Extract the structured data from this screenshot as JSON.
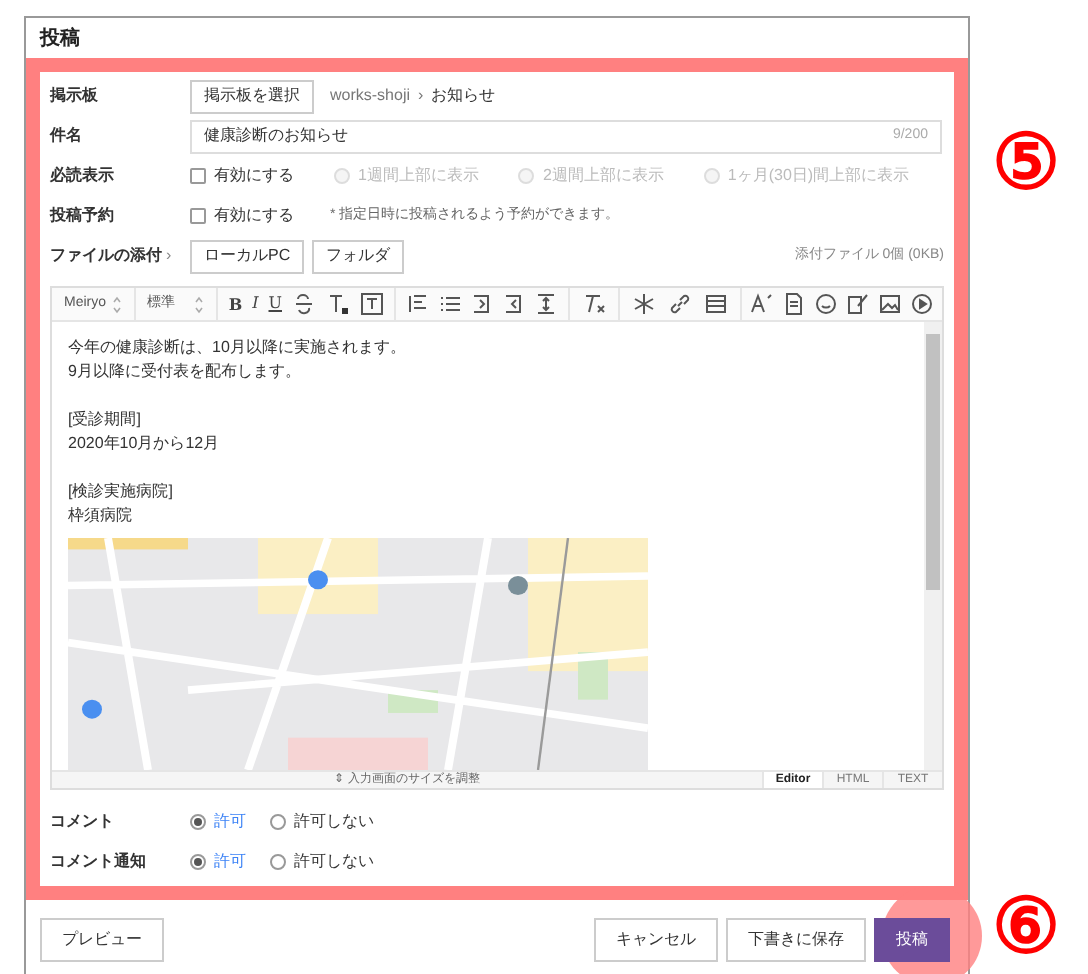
{
  "window": {
    "title": "投稿"
  },
  "form": {
    "board": {
      "label": "掲示板",
      "button": "掲示板を選択",
      "path": "works-shoji",
      "separator": "›",
      "board_name": "お知らせ"
    },
    "subject": {
      "label": "件名",
      "value": "健康診断のお知らせ",
      "counter": "9/200"
    },
    "pinned": {
      "label": "必読表示",
      "enable": {
        "label": "有効にする",
        "checked": false
      },
      "options": [
        {
          "label": "1週間上部に表示",
          "selected": false,
          "disabled": true
        },
        {
          "label": "2週間上部に表示",
          "selected": false,
          "disabled": true
        },
        {
          "label": "1ヶ月(30日)間上部に表示",
          "selected": false,
          "disabled": true
        }
      ]
    },
    "schedule": {
      "label": "投稿予約",
      "enable": {
        "label": "有効にする",
        "checked": false
      },
      "note": "* 指定日時に投稿されるよう予約ができます。"
    },
    "attachment": {
      "label": "ファイルの添付",
      "arrow": "›",
      "buttons": [
        "ローカルPC",
        "フォルダ"
      ],
      "summary": "添付ファイル 0個 (0KB)"
    }
  },
  "editor": {
    "font": "Meiryo",
    "size": "標準",
    "format_letters": [
      "B",
      "I",
      "U"
    ],
    "paragraphs": [
      [
        "今年の健康診断は、10月以降に実施されます。",
        "9月以降に受付表を配布します。"
      ],
      [
        "[受診期間]",
        "2020年10月から12月"
      ],
      [
        "[検診実施病院]",
        "枠須病院"
      ]
    ],
    "resize_icon": "⇕",
    "resize_hint": "入力画面のサイズを調整",
    "modes": [
      {
        "label": "Editor",
        "selected": true
      },
      {
        "label": "HTML",
        "selected": false
      },
      {
        "label": "TEXT",
        "selected": false
      }
    ]
  },
  "comments": [
    {
      "label": "コメント",
      "options": [
        {
          "label": "許可",
          "selected": true
        },
        {
          "label": "許可しない",
          "selected": false
        }
      ]
    },
    {
      "label": "コメント通知",
      "options": [
        {
          "label": "許可",
          "selected": true
        },
        {
          "label": "許可しない",
          "selected": false
        }
      ]
    }
  ],
  "footer": {
    "preview": "プレビュー",
    "cancel": "キャンセル",
    "save_draft": "下書きに保存",
    "submit": "投稿"
  },
  "annotations": [
    "⑤",
    "⑥"
  ]
}
